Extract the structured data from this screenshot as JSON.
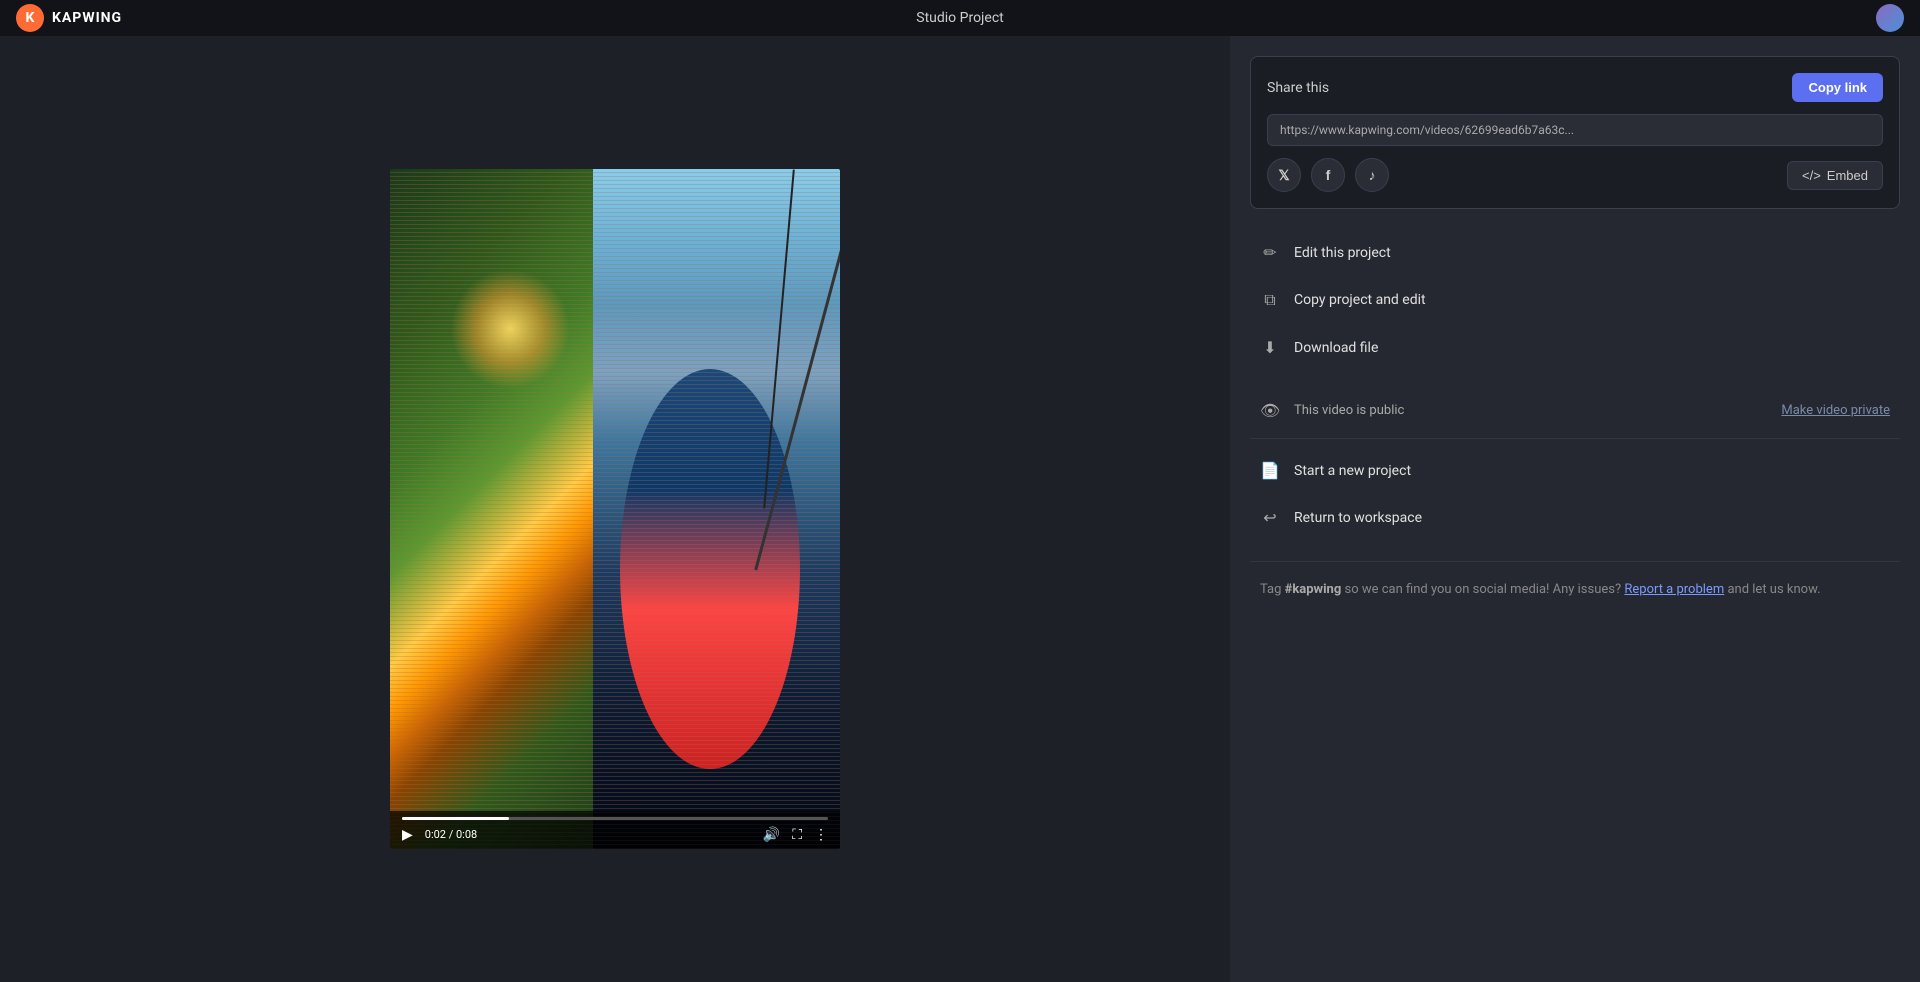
{
  "header": {
    "logo_icon": "K",
    "logo_name": "KAPWING",
    "title": "Studio Project",
    "avatar_alt": "User avatar"
  },
  "share_section": {
    "label": "Share this",
    "copy_btn": "Copy link",
    "url": "https://www.kapwing.com/videos/62699ead6b7a63c...",
    "twitter_icon": "𝕏",
    "facebook_icon": "f",
    "tiktok_icon": "♪",
    "embed_label": "Embed",
    "embed_icon": "<>"
  },
  "actions": [
    {
      "id": "edit-project",
      "icon": "✏️",
      "label": "Edit this project"
    },
    {
      "id": "copy-project",
      "icon": "⧉",
      "label": "Copy project and edit"
    },
    {
      "id": "download-file",
      "icon": "⬇",
      "label": "Download file"
    }
  ],
  "visibility": {
    "icon": "👁",
    "status": "This video is public",
    "make_private": "Make video private"
  },
  "secondary_actions": [
    {
      "id": "new-project",
      "icon": "📄",
      "label": "Start a new project"
    },
    {
      "id": "return-workspace",
      "icon": "↩",
      "label": "Return to workspace"
    }
  ],
  "tag_text": {
    "prefix": "Tag ",
    "hashtag": "#kapwing",
    "middle": " so we can find you on social media! Any issues? ",
    "link_text": "Report a problem",
    "suffix": " and let us know."
  },
  "video": {
    "time_current": "0:02",
    "time_total": "0:08",
    "progress_percent": 25
  },
  "colors": {
    "bg": "#1e2028",
    "panel": "#252830",
    "accent": "#5b6ff0"
  }
}
